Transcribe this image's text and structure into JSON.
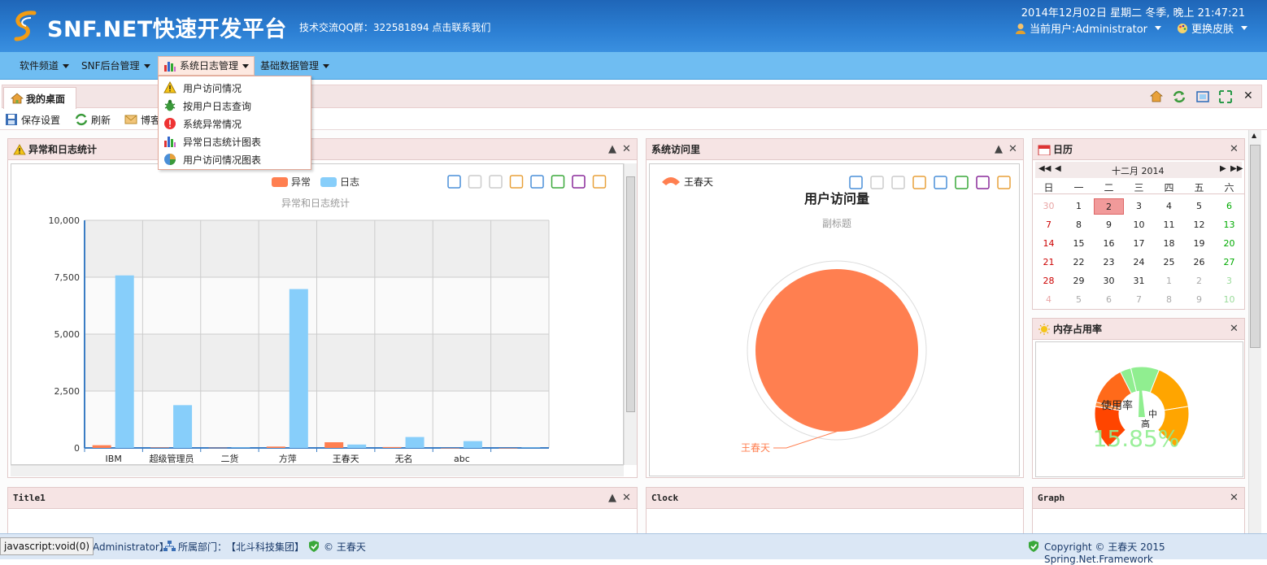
{
  "header": {
    "app_title": "SNF.NET快速开发平台",
    "subtitle": "技术交流QQ群：322581894 点击联系我们",
    "datetime": "2014年12月02日 星期二 冬季, 晚上 21:47:21",
    "current_user": "当前用户:Administrator",
    "change_skin": "更换皮肤"
  },
  "menu": {
    "items": [
      {
        "label": "软件频道"
      },
      {
        "label": "SNF后台管理"
      },
      {
        "label": "系统日志管理"
      },
      {
        "label": "基础数据管理"
      }
    ],
    "dropdown": [
      {
        "label": "用户访问情况",
        "icon": "warning-icon"
      },
      {
        "label": "按用户日志查询",
        "icon": "bug-icon"
      },
      {
        "label": "系统异常情况",
        "icon": "error-icon"
      },
      {
        "label": "异常日志统计图表",
        "icon": "bar-chart-icon"
      },
      {
        "label": "用户访问情况图表",
        "icon": "pie-chart-icon"
      }
    ]
  },
  "tabs": {
    "desktop": "我的桌面"
  },
  "toolbar": {
    "save": "保存设置",
    "refresh": "刷新",
    "blog": "博客"
  },
  "panels": {
    "log_stats": {
      "title": "异常和日志统计"
    },
    "visits": {
      "title": "系统访问里"
    },
    "calendar": {
      "title": "日历"
    },
    "memory": {
      "title": "内存占用率"
    },
    "title1": {
      "title": "Title1"
    },
    "clock": {
      "title": "Clock"
    },
    "graph": {
      "title": "Graph"
    }
  },
  "chart_data": [
    {
      "type": "bar",
      "title": "异常和日志统计",
      "categories": [
        "IBM",
        "超级管理员",
        "二货",
        "方萍",
        "王春天",
        "无名",
        "abc",
        ""
      ],
      "series": [
        {
          "name": "异常",
          "color": "#ff7f50",
          "values": [
            120,
            20,
            10,
            60,
            250,
            40,
            0,
            0
          ]
        },
        {
          "name": "日志",
          "color": "#87cefa",
          "values": [
            7580,
            1880,
            20,
            6980,
            150,
            480,
            300,
            20
          ]
        }
      ],
      "ylim": [
        0,
        10000
      ],
      "yticks": [
        "0",
        "2,500",
        "5,000",
        "7,500",
        "10,000"
      ],
      "legend": "top-center",
      "grid": true
    },
    {
      "type": "pie",
      "title": "用户访问量",
      "subtitle": "副标题",
      "slices": [
        {
          "label": "王春天",
          "value": 100,
          "color": "#ff7f50"
        }
      ],
      "legend": "top-left"
    },
    {
      "type": "gauge",
      "label": "使用率",
      "value_text": "15.85%",
      "value": 15.85,
      "scale_labels": [
        "中",
        "高"
      ],
      "value_color": "#90ee90"
    }
  ],
  "calendar": {
    "month_label": "十二月 2014",
    "weekdays": [
      "日",
      "一",
      "二",
      "三",
      "四",
      "五",
      "六"
    ],
    "weeks": [
      [
        "30",
        "1",
        "2",
        "3",
        "4",
        "5",
        "6"
      ],
      [
        "7",
        "8",
        "9",
        "10",
        "11",
        "12",
        "13"
      ],
      [
        "14",
        "15",
        "16",
        "17",
        "18",
        "19",
        "20"
      ],
      [
        "21",
        "22",
        "23",
        "24",
        "25",
        "26",
        "27"
      ],
      [
        "28",
        "29",
        "30",
        "31",
        "1",
        "2",
        "3"
      ],
      [
        "4",
        "5",
        "6",
        "7",
        "8",
        "9",
        "10"
      ]
    ],
    "today": "2"
  },
  "statusbar": {
    "tooltip": "javascript:void(0)",
    "user": "【Administrator】",
    "dept_label": "所属部门：",
    "dept": "【北斗科技集团】",
    "author": "© 王春天",
    "copyright": "Copyright © 王春天 2015 Spring.Net.Framework"
  },
  "colors": {
    "header_blue": "#2c7fd3",
    "menu_blue": "#6fbdf2",
    "panel_head": "#f6e4e4",
    "accent_orange": "#ff7f50",
    "accent_blue": "#87cefa"
  }
}
